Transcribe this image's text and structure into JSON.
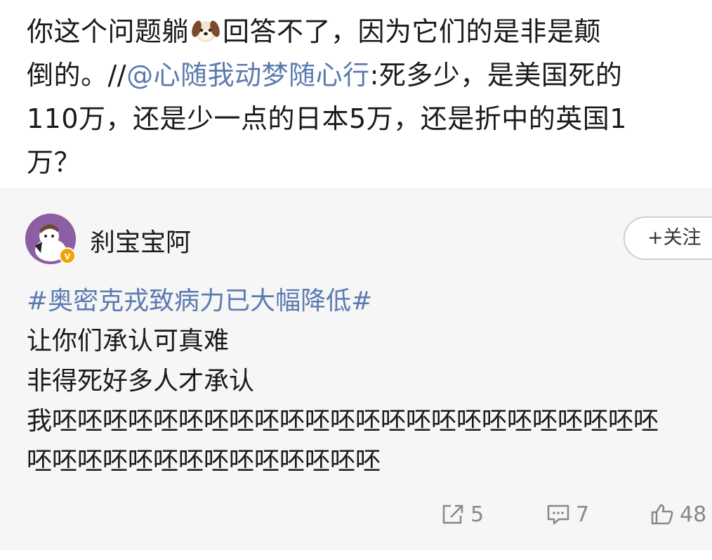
{
  "top_post": {
    "line1_before": "你这个问题躺",
    "line1_emoji": "dog-emoji",
    "line1_after": "回答不了，因为它们的是非是颠",
    "line2_prefix": "倒的。//",
    "line2_mention": "@心随我动梦随心行",
    "line2_rest": ":死多少，是美国死的",
    "line3": "110万，还是少一点的日本5万，还是折中的英国1",
    "line4": "万？"
  },
  "card": {
    "username": "刹宝宝阿",
    "follow_label": "+关注",
    "hashtag": "#奥密克戎致病力已大幅降低#",
    "lines": [
      "让你们承认可真难",
      "非得死好多人才承认",
      "我呸呸呸呸呸呸呸呸呸呸呸呸呸呸呸呸呸呸呸呸呸呸呸呸",
      "呸呸呸呸呸呸呸呸呸呸呸呸呸呸"
    ],
    "actions": {
      "repost_count": "5",
      "comment_count": "7",
      "like_count": "48"
    }
  },
  "colors": {
    "link": "#5b7bb0",
    "card_bg": "#f6f6f6",
    "meta": "#888888",
    "verified": "#f2a100"
  }
}
